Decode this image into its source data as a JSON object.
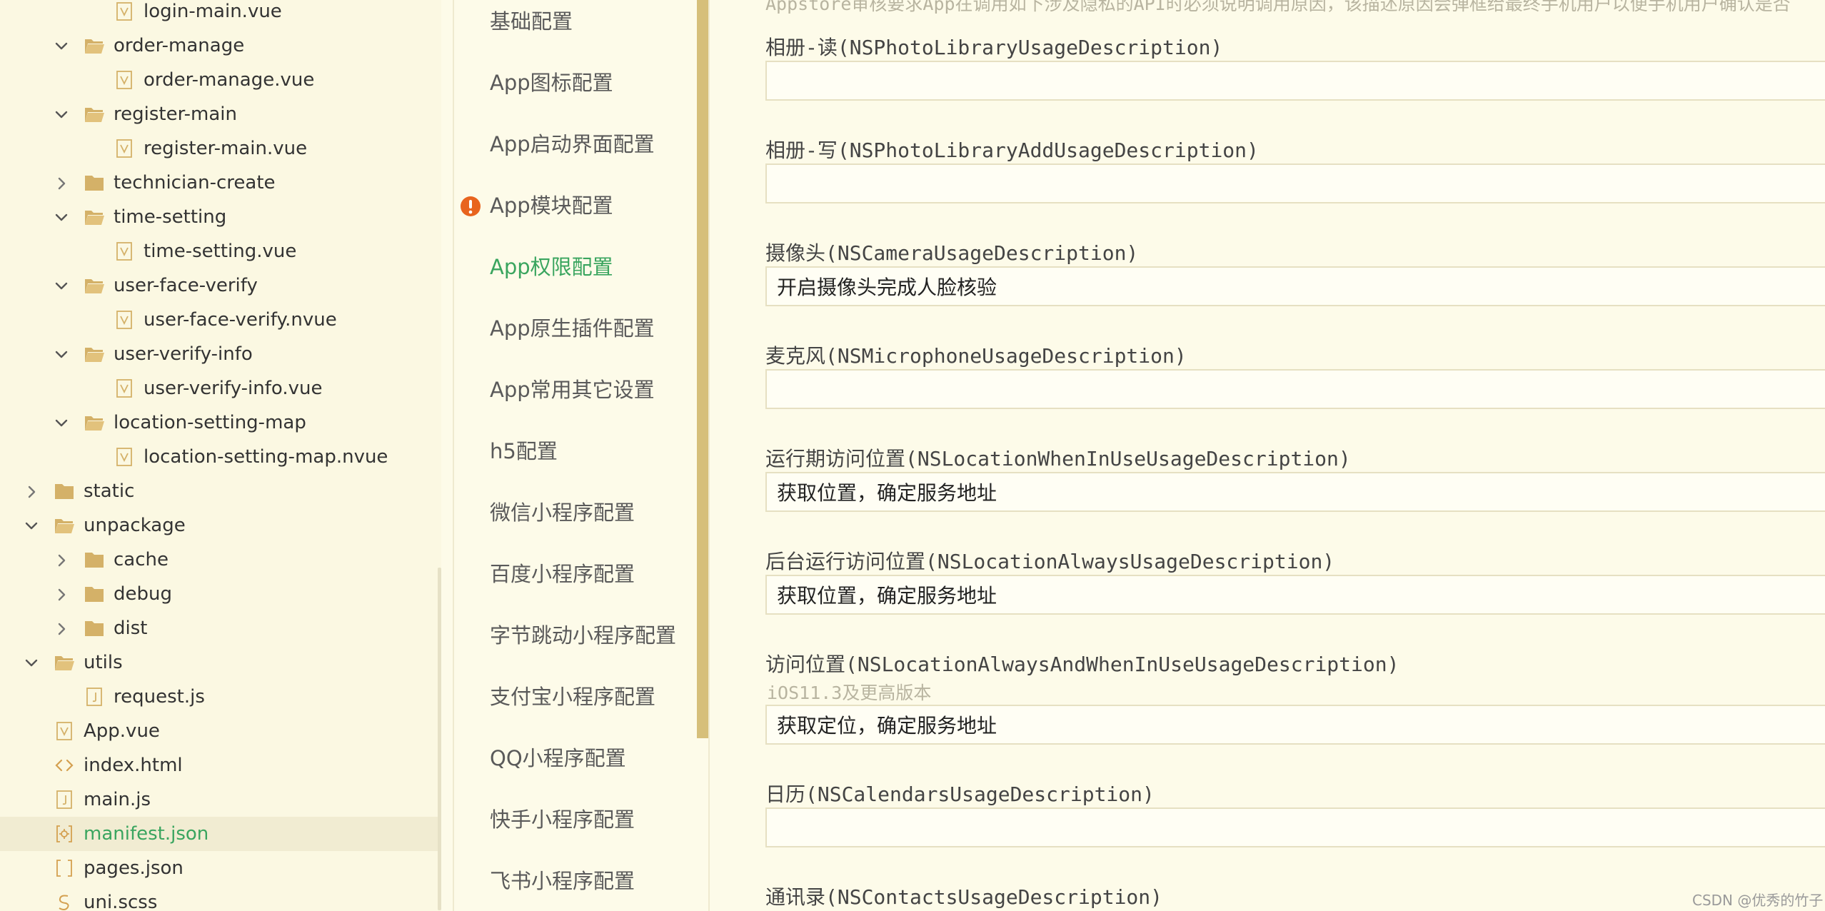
{
  "file_tree": [
    {
      "label": "login-main.vue",
      "type": "vue",
      "expanded": null,
      "active": false
    },
    {
      "label": "order-manage",
      "type": "folder",
      "expanded": true,
      "active": false
    },
    {
      "label": "order-manage.vue",
      "type": "vue",
      "expanded": null,
      "active": false
    },
    {
      "label": "register-main",
      "type": "folder",
      "expanded": true,
      "active": false
    },
    {
      "label": "register-main.vue",
      "type": "vue",
      "expanded": null,
      "active": false
    },
    {
      "label": "technician-create",
      "type": "folder",
      "expanded": false,
      "active": false
    },
    {
      "label": "time-setting",
      "type": "folder",
      "expanded": true,
      "active": false
    },
    {
      "label": "time-setting.vue",
      "type": "vue",
      "expanded": null,
      "active": false
    },
    {
      "label": "user-face-verify",
      "type": "folder",
      "expanded": true,
      "active": false
    },
    {
      "label": "user-face-verify.nvue",
      "type": "vue",
      "expanded": null,
      "active": false
    },
    {
      "label": "user-verify-info",
      "type": "folder",
      "expanded": true,
      "active": false
    },
    {
      "label": "user-verify-info.vue",
      "type": "vue",
      "expanded": null,
      "active": false
    },
    {
      "label": "location-setting-map",
      "type": "folder",
      "expanded": true,
      "active": false
    },
    {
      "label": "location-setting-map.nvue",
      "type": "vue",
      "expanded": null,
      "active": false
    },
    {
      "label": "static",
      "type": "folder",
      "expanded": false,
      "active": false
    },
    {
      "label": "unpackage",
      "type": "folder",
      "expanded": true,
      "active": false
    },
    {
      "label": "cache",
      "type": "folder",
      "expanded": false,
      "active": false
    },
    {
      "label": "debug",
      "type": "folder",
      "expanded": false,
      "active": false
    },
    {
      "label": "dist",
      "type": "folder",
      "expanded": false,
      "active": false
    },
    {
      "label": "utils",
      "type": "folder",
      "expanded": true,
      "active": false
    },
    {
      "label": "request.js",
      "type": "js",
      "expanded": null,
      "active": false
    },
    {
      "label": "App.vue",
      "type": "vue",
      "expanded": null,
      "active": false
    },
    {
      "label": "index.html",
      "type": "html",
      "expanded": null,
      "active": false
    },
    {
      "label": "main.js",
      "type": "js",
      "expanded": null,
      "active": false
    },
    {
      "label": "manifest.json",
      "type": "json",
      "expanded": null,
      "active": true
    },
    {
      "label": "pages.json",
      "type": "brackets",
      "expanded": null,
      "active": false
    },
    {
      "label": "uni.scss",
      "type": "scss",
      "expanded": null,
      "active": false
    }
  ],
  "settings_nav": [
    {
      "label": "基础配置",
      "active": false,
      "warning": false
    },
    {
      "label": "App图标配置",
      "active": false,
      "warning": false
    },
    {
      "label": "App启动界面配置",
      "active": false,
      "warning": false
    },
    {
      "label": "App模块配置",
      "active": false,
      "warning": true
    },
    {
      "label": "App权限配置",
      "active": true,
      "warning": false
    },
    {
      "label": "App原生插件配置",
      "active": false,
      "warning": false
    },
    {
      "label": "App常用其它设置",
      "active": false,
      "warning": false
    },
    {
      "label": "h5配置",
      "active": false,
      "warning": false
    },
    {
      "label": "微信小程序配置",
      "active": false,
      "warning": false
    },
    {
      "label": "百度小程序配置",
      "active": false,
      "warning": false
    },
    {
      "label": "字节跳动小程序配置",
      "active": false,
      "warning": false
    },
    {
      "label": "支付宝小程序配置",
      "active": false,
      "warning": false
    },
    {
      "label": "QQ小程序配置",
      "active": false,
      "warning": false
    },
    {
      "label": "快手小程序配置",
      "active": false,
      "warning": false
    },
    {
      "label": "飞书小程序配置",
      "active": false,
      "warning": false
    }
  ],
  "permissions": {
    "intro": "Appstore审核要求App在调用如下涉及隐私的API时必须说明调用原因，该描述原因会弹框给最终手机用户以便手机用户确认是否",
    "fields": [
      {
        "label": "相册-读(NSPhotoLibraryUsageDescription)",
        "value": "",
        "hint": ""
      },
      {
        "label": "相册-写(NSPhotoLibraryAddUsageDescription)",
        "value": "",
        "hint": ""
      },
      {
        "label": "摄像头(NSCameraUsageDescription)",
        "value": "开启摄像头完成人脸核验",
        "hint": ""
      },
      {
        "label": "麦克风(NSMicrophoneUsageDescription)",
        "value": "",
        "hint": ""
      },
      {
        "label": "运行期访问位置(NSLocationWhenInUseUsageDescription)",
        "value": "获取位置，确定服务地址",
        "hint": ""
      },
      {
        "label": "后台运行访问位置(NSLocationAlwaysUsageDescription)",
        "value": "获取位置，确定服务地址",
        "hint": ""
      },
      {
        "label": "访问位置(NSLocationAlwaysAndWhenInUseUsageDescription)",
        "value": "获取定位，确定服务地址",
        "hint": "iOS11.3及更高版本"
      },
      {
        "label": "日历(NSCalendarsUsageDescription)",
        "value": "",
        "hint": ""
      },
      {
        "label": "通讯录(NSContactsUsageDescription)",
        "value": "",
        "hint": ""
      }
    ]
  },
  "watermark": "CSDN @优秀的竹子",
  "colors": {
    "accent_green": "#3aa55f",
    "folder": "#d4b168",
    "warning": "#e8641e",
    "scrollbar": "#d6bf7a"
  }
}
